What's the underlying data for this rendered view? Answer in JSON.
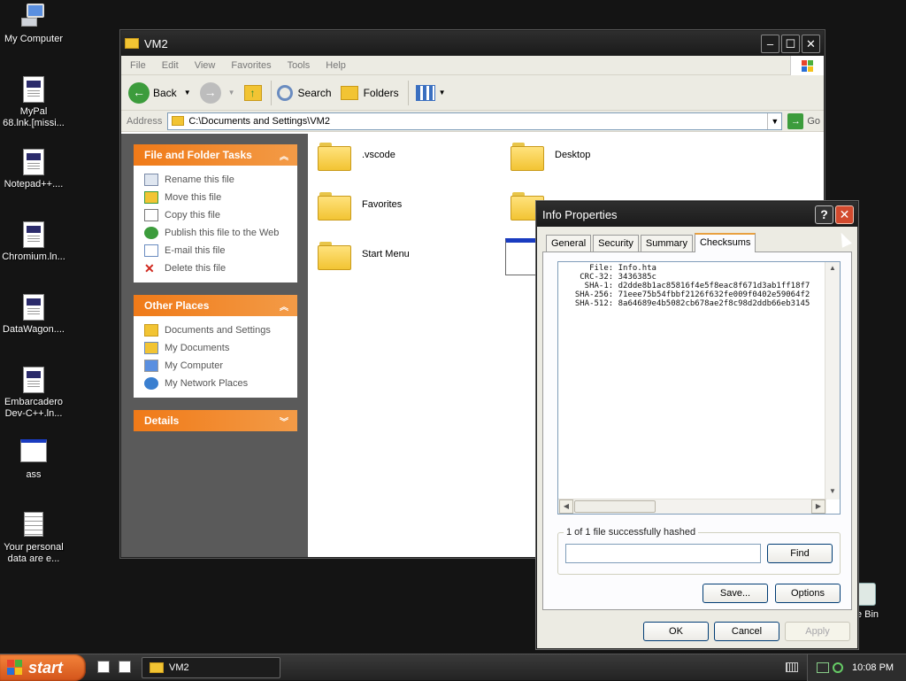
{
  "desktop": {
    "icons": [
      {
        "label": "My Computer"
      },
      {
        "label": "MyPal\n68.lnk.[missi..."
      },
      {
        "label": "Notepad++...."
      },
      {
        "label": "Chromium.ln..."
      },
      {
        "label": "DataWagon...."
      },
      {
        "label": "Embarcadero\nDev-C++.ln..."
      },
      {
        "label": "ass"
      },
      {
        "label": "Your personal\ndata are e..."
      },
      {
        "label": "cle Bin"
      }
    ]
  },
  "explorer": {
    "title": "VM2",
    "menu": [
      "File",
      "Edit",
      "View",
      "Favorites",
      "Tools",
      "Help"
    ],
    "toolbar": {
      "back": "Back",
      "search": "Search",
      "folders": "Folders"
    },
    "address_label": "Address",
    "address_value": "C:\\Documents and Settings\\VM2",
    "go_label": "Go",
    "panels": {
      "file_tasks": {
        "title": "File and Folder Tasks",
        "items": [
          "Rename this file",
          "Move this file",
          "Copy this file",
          "Publish this file to the Web",
          "E-mail this file",
          "Delete this file"
        ]
      },
      "other_places": {
        "title": "Other Places",
        "items": [
          "Documents and Settings",
          "My Documents",
          "My Computer",
          "My Network Places"
        ]
      },
      "details": {
        "title": "Details"
      }
    },
    "files": [
      ".vscode",
      "Desktop",
      "Favorites",
      "Start Menu"
    ]
  },
  "dialog": {
    "title": "Info Properties",
    "tabs": [
      "General",
      "Security",
      "Summary",
      "Checksums"
    ],
    "active_tab": "Checksums",
    "hash_lines": [
      "     File: Info.hta",
      "   CRC-32: 3436385c",
      "    SHA-1: d2dde8b1ac85816f4e5f8eac8f671d3ab1ff18f7",
      "  SHA-256: 71eee75b54fbbf2126f632fe009f0402e59064f2",
      "  SHA-512: 8a64689e4b5082cb678ae2f8c98d2ddb66eb3145"
    ],
    "status": "1 of 1 file successfully hashed",
    "find_label": "Find",
    "save_label": "Save...",
    "options_label": "Options",
    "ok_label": "OK",
    "cancel_label": "Cancel",
    "apply_label": "Apply"
  },
  "taskbar": {
    "start_label": "start",
    "task_item": "VM2",
    "clock": "10:08 PM"
  }
}
